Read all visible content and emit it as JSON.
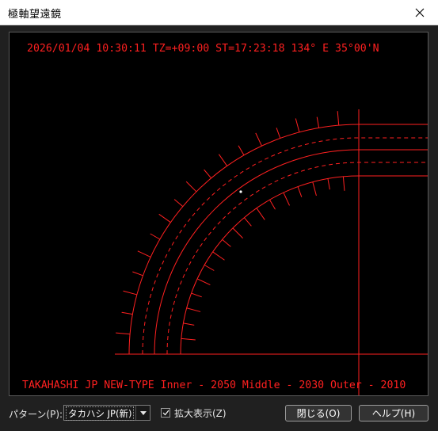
{
  "window": {
    "title": "極軸望遠鏡"
  },
  "scope": {
    "status_line": "2026/01/04 10:30:11 TZ=+09:00  ST=17:23:18  134°   E 35°00'N",
    "pattern_line": "TAKAHASHI JP NEW-TYPE Inner - 2050  Middle - 2030 Outer - 2010",
    "colors": {
      "background": "#000000",
      "reticle": "#ff2020",
      "star": "#ffffff"
    }
  },
  "controls": {
    "pattern_label": "パターン(P):",
    "pattern_value": "タカハシ JP(新)",
    "magnify_label": "拡大表示(Z)",
    "magnify_checked": true,
    "close_button": "閉じる(O)",
    "help_button": "ヘルプ(H)"
  }
}
